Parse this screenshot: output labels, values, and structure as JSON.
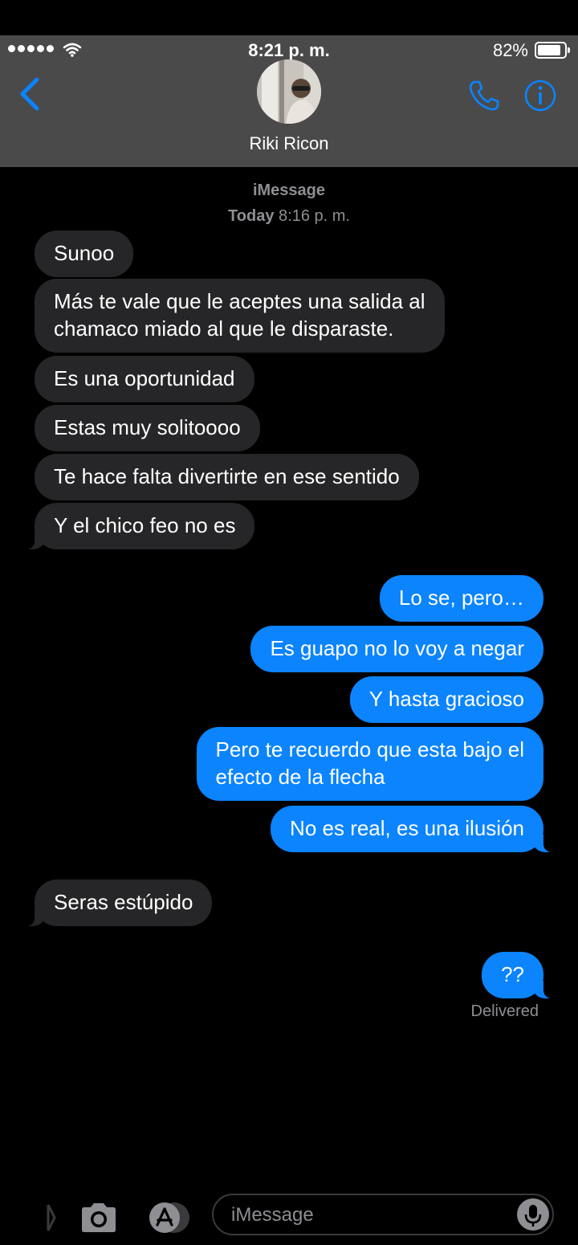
{
  "status_bar": {
    "time": "8:21 p. m.",
    "battery": "82%",
    "battery_level": 0.82
  },
  "nav": {
    "contact_name": "Riki Ricon"
  },
  "conversation": {
    "service": "iMessage",
    "timestamp_day": "Today",
    "timestamp_time": "8:16 p. m.",
    "delivered": "Delivered",
    "messages": [
      {
        "dir": "in",
        "text": "Sunoo"
      },
      {
        "dir": "in",
        "text": "Más te vale que le aceptes una salida al\nchamaco miado al que le disparaste."
      },
      {
        "dir": "in",
        "text": "Es una oportunidad"
      },
      {
        "dir": "in",
        "text": "Estas muy solitoooo"
      },
      {
        "dir": "in",
        "text": "Te hace falta divertirte en ese sentido"
      },
      {
        "dir": "in",
        "text": "Y el chico feo no es"
      },
      {
        "dir": "out",
        "text": "Lo se, pero…"
      },
      {
        "dir": "out",
        "text": "Es guapo no lo voy a negar"
      },
      {
        "dir": "out",
        "text": "Y hasta gracioso"
      },
      {
        "dir": "out",
        "text": "Pero te recuerdo que esta bajo el\nefecto de la flecha"
      },
      {
        "dir": "out",
        "text": "No es real, es una ilusión"
      },
      {
        "dir": "in",
        "text": "Seras estúpido"
      },
      {
        "dir": "out",
        "text": "??"
      }
    ]
  },
  "composer": {
    "placeholder": "iMessage"
  },
  "colors": {
    "outgoing_bubble": "#0b84fe",
    "incoming_bubble": "#262628",
    "accent": "#0a84ff",
    "header_bg": "#4a4a4b"
  }
}
